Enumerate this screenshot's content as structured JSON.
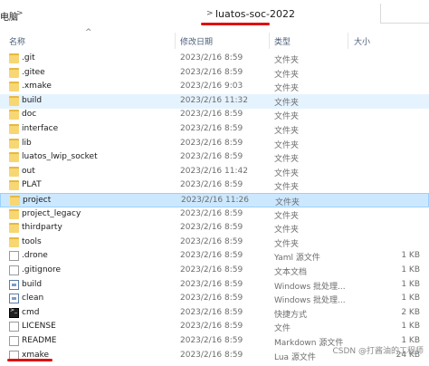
{
  "address": {
    "crumb_parent": "电脑",
    "separator1": ">",
    "separator2": ">",
    "current_folder": "luatos-soc-2022"
  },
  "columns": {
    "name": "名称",
    "date": "修改日期",
    "type": "类型",
    "size": "大小",
    "sort_indicator": "^"
  },
  "rows": [
    {
      "name": ".git",
      "date": "2023/2/16 8:59",
      "type": "文件夹",
      "size": "",
      "icon": "folder-icon",
      "state": ""
    },
    {
      "name": ".gitee",
      "date": "2023/2/16 8:59",
      "type": "文件夹",
      "size": "",
      "icon": "folder-icon",
      "state": ""
    },
    {
      "name": ".xmake",
      "date": "2023/2/16 9:03",
      "type": "文件夹",
      "size": "",
      "icon": "folder-icon",
      "state": ""
    },
    {
      "name": "build",
      "date": "2023/2/16 11:32",
      "type": "文件夹",
      "size": "",
      "icon": "folder-icon",
      "state": "hover"
    },
    {
      "name": "doc",
      "date": "2023/2/16 8:59",
      "type": "文件夹",
      "size": "",
      "icon": "folder-icon",
      "state": ""
    },
    {
      "name": "interface",
      "date": "2023/2/16 8:59",
      "type": "文件夹",
      "size": "",
      "icon": "folder-icon",
      "state": ""
    },
    {
      "name": "lib",
      "date": "2023/2/16 8:59",
      "type": "文件夹",
      "size": "",
      "icon": "folder-icon",
      "state": ""
    },
    {
      "name": "luatos_lwip_socket",
      "date": "2023/2/16 8:59",
      "type": "文件夹",
      "size": "",
      "icon": "folder-icon",
      "state": ""
    },
    {
      "name": "out",
      "date": "2023/2/16 11:42",
      "type": "文件夹",
      "size": "",
      "icon": "folder-icon",
      "state": ""
    },
    {
      "name": "PLAT",
      "date": "2023/2/16 8:59",
      "type": "文件夹",
      "size": "",
      "icon": "folder-icon",
      "state": ""
    },
    {
      "name": "project",
      "date": "2023/2/16 11:26",
      "type": "文件夹",
      "size": "",
      "icon": "folder-icon",
      "state": "selected"
    },
    {
      "name": "project_legacy",
      "date": "2023/2/16 8:59",
      "type": "文件夹",
      "size": "",
      "icon": "folder-icon",
      "state": ""
    },
    {
      "name": "thirdparty",
      "date": "2023/2/16 8:59",
      "type": "文件夹",
      "size": "",
      "icon": "folder-icon",
      "state": ""
    },
    {
      "name": "tools",
      "date": "2023/2/16 8:59",
      "type": "文件夹",
      "size": "",
      "icon": "folder-icon",
      "state": ""
    },
    {
      "name": ".drone",
      "date": "2023/2/16 8:59",
      "type": "Yaml 源文件",
      "size": "1 KB",
      "icon": "file-icon",
      "state": ""
    },
    {
      "name": ".gitignore",
      "date": "2023/2/16 8:59",
      "type": "文本文档",
      "size": "1 KB",
      "icon": "file-icon",
      "state": ""
    },
    {
      "name": "build",
      "date": "2023/2/16 8:59",
      "type": "Windows 批处理...",
      "size": "1 KB",
      "icon": "batch-file-icon",
      "state": ""
    },
    {
      "name": "clean",
      "date": "2023/2/16 8:59",
      "type": "Windows 批处理...",
      "size": "1 KB",
      "icon": "batch-file-icon",
      "state": ""
    },
    {
      "name": "cmd",
      "date": "2023/2/16 8:59",
      "type": "快捷方式",
      "size": "2 KB",
      "icon": "cmd-shortcut-icon",
      "state": ""
    },
    {
      "name": "LICENSE",
      "date": "2023/2/16 8:59",
      "type": "文件",
      "size": "1 KB",
      "icon": "file-icon",
      "state": ""
    },
    {
      "name": "README",
      "date": "2023/2/16 8:59",
      "type": "Markdown 源文件",
      "size": "1 KB",
      "icon": "file-icon",
      "state": ""
    },
    {
      "name": "xmake",
      "date": "2023/2/16 8:59",
      "type": "Lua 源文件",
      "size": "24 KB",
      "icon": "file-icon",
      "state": ""
    }
  ],
  "watermark": "CSDN @打酱油的工程师"
}
